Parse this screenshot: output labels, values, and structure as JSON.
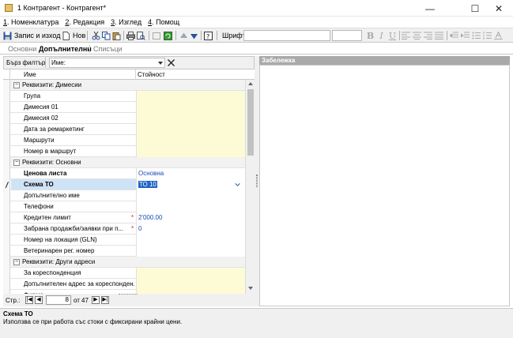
{
  "window": {
    "title": "1 Контрагент - Контрагент*",
    "minimize": "—",
    "maximize": "☐",
    "close": "✕"
  },
  "menu": [
    {
      "key": "1",
      "label": ". Номенклатура"
    },
    {
      "key": "2",
      "label": ". Редакция"
    },
    {
      "key": "3",
      "label": ". Изглед"
    },
    {
      "key": "4",
      "label": ". Помощ"
    }
  ],
  "toolbar": {
    "save_exit": "Запис и изход",
    "new": "Нов",
    "font_label": "Шрифт:",
    "font_value": ""
  },
  "tabs": [
    {
      "label": "Основни",
      "active": false
    },
    {
      "label": "Допълнителни",
      "active": true
    },
    {
      "label": "Списъци",
      "active": false
    }
  ],
  "filter": {
    "quick_label": "Бърз филтър",
    "field_label": "Име:",
    "value": ""
  },
  "grid": {
    "col_name": "Име",
    "col_value": "Стойност",
    "rows": [
      {
        "type": "group",
        "name": "Реквизити: Димесии"
      },
      {
        "type": "item",
        "name": "Група",
        "value": ""
      },
      {
        "type": "item",
        "name": "Димесия 01",
        "value": ""
      },
      {
        "type": "item",
        "name": "Димесия 02",
        "value": ""
      },
      {
        "type": "item",
        "name": "Дата за ремаркетинг",
        "value": ""
      },
      {
        "type": "item",
        "name": "Маршрути",
        "value": ""
      },
      {
        "type": "item",
        "name": "Номер в маршрут",
        "value": ""
      },
      {
        "type": "group",
        "name": "Реквизити: Основни"
      },
      {
        "type": "item",
        "name": "Ценова листа",
        "value": "Основна",
        "bold": true,
        "white": true
      },
      {
        "type": "item",
        "name": "Схема ТО",
        "value": "ТО 10",
        "bold": true,
        "selected": true
      },
      {
        "type": "item",
        "name": "Допълнително име",
        "value": "",
        "white": true
      },
      {
        "type": "item",
        "name": "Телефони",
        "value": "",
        "white": true
      },
      {
        "type": "item",
        "name": "Кредитен лимит",
        "value": "2'000.00",
        "required": true,
        "white": true
      },
      {
        "type": "item",
        "name": "Забрана продажби/заявки при п...",
        "value": "0",
        "required": true,
        "white": true
      },
      {
        "type": "item",
        "name": "Номер на локация (GLN)",
        "value": "",
        "white": true
      },
      {
        "type": "item",
        "name": "Ветеринарен рег. номер",
        "value": "",
        "white": true
      },
      {
        "type": "group",
        "name": "Реквизити: Други адреси"
      },
      {
        "type": "item",
        "name": "За кореспонденция",
        "value": ""
      },
      {
        "type": "item",
        "name": "Допълнителен адрес за кореспонден...",
        "value": ""
      },
      {
        "type": "item",
        "name": "Фирма",
        "value": ""
      }
    ]
  },
  "nav": {
    "label": "Стр.:",
    "current": "8",
    "of_label": "от",
    "total": "47"
  },
  "note": {
    "header": "Забележка"
  },
  "status": {
    "title": "Схема ТО",
    "description": "Използва се при работа със стоки с фиксирани крайни цени."
  }
}
